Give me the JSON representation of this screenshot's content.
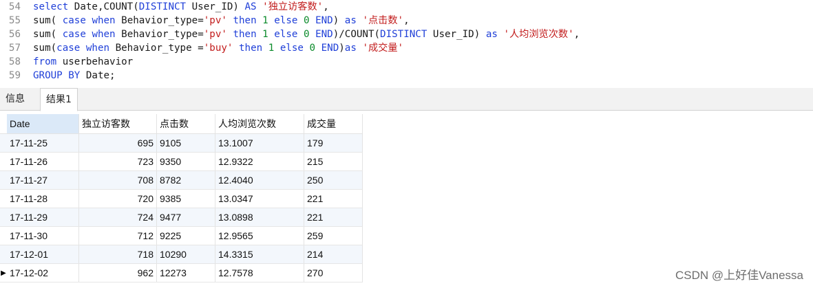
{
  "editor": {
    "lines": [
      {
        "no": "54",
        "parts": [
          {
            "t": "kw",
            "v": "select"
          },
          {
            "t": "id",
            "v": " Date,COUNT("
          },
          {
            "t": "kw",
            "v": "DISTINCT"
          },
          {
            "t": "id",
            "v": " User_ID) "
          },
          {
            "t": "kw",
            "v": "AS"
          },
          {
            "t": "id",
            "v": " "
          },
          {
            "t": "str",
            "v": "'独立访客数'"
          },
          {
            "t": "id",
            "v": ","
          }
        ]
      },
      {
        "no": "55",
        "parts": [
          {
            "t": "id",
            "v": "sum( "
          },
          {
            "t": "kw",
            "v": "case"
          },
          {
            "t": "id",
            "v": " "
          },
          {
            "t": "kw",
            "v": "when"
          },
          {
            "t": "id",
            "v": " Behavior_type="
          },
          {
            "t": "str",
            "v": "'pv'"
          },
          {
            "t": "id",
            "v": " "
          },
          {
            "t": "kw",
            "v": "then"
          },
          {
            "t": "id",
            "v": " "
          },
          {
            "t": "num",
            "v": "1"
          },
          {
            "t": "id",
            "v": " "
          },
          {
            "t": "kw",
            "v": "else"
          },
          {
            "t": "id",
            "v": " "
          },
          {
            "t": "num",
            "v": "0"
          },
          {
            "t": "id",
            "v": " "
          },
          {
            "t": "kw",
            "v": "END"
          },
          {
            "t": "id",
            "v": ") "
          },
          {
            "t": "kw",
            "v": "as"
          },
          {
            "t": "id",
            "v": " "
          },
          {
            "t": "str",
            "v": "'点击数'"
          },
          {
            "t": "id",
            "v": ","
          }
        ]
      },
      {
        "no": "56",
        "parts": [
          {
            "t": "id",
            "v": "sum( "
          },
          {
            "t": "kw",
            "v": "case"
          },
          {
            "t": "id",
            "v": " "
          },
          {
            "t": "kw",
            "v": "when"
          },
          {
            "t": "id",
            "v": " Behavior_type="
          },
          {
            "t": "str",
            "v": "'pv'"
          },
          {
            "t": "id",
            "v": " "
          },
          {
            "t": "kw",
            "v": "then"
          },
          {
            "t": "id",
            "v": " "
          },
          {
            "t": "num",
            "v": "1"
          },
          {
            "t": "id",
            "v": " "
          },
          {
            "t": "kw",
            "v": "else"
          },
          {
            "t": "id",
            "v": " "
          },
          {
            "t": "num",
            "v": "0"
          },
          {
            "t": "id",
            "v": " "
          },
          {
            "t": "kw",
            "v": "END"
          },
          {
            "t": "id",
            "v": ")/COUNT("
          },
          {
            "t": "kw",
            "v": "DISTINCT"
          },
          {
            "t": "id",
            "v": " User_ID) "
          },
          {
            "t": "kw",
            "v": "as"
          },
          {
            "t": "id",
            "v": " "
          },
          {
            "t": "str",
            "v": "'人均浏览次数'"
          },
          {
            "t": "id",
            "v": ","
          }
        ]
      },
      {
        "no": "57",
        "parts": [
          {
            "t": "id",
            "v": "sum("
          },
          {
            "t": "kw",
            "v": "case"
          },
          {
            "t": "id",
            "v": " "
          },
          {
            "t": "kw",
            "v": "when"
          },
          {
            "t": "id",
            "v": " Behavior_type ="
          },
          {
            "t": "str",
            "v": "'buy'"
          },
          {
            "t": "id",
            "v": " "
          },
          {
            "t": "kw",
            "v": "then"
          },
          {
            "t": "id",
            "v": " "
          },
          {
            "t": "num",
            "v": "1"
          },
          {
            "t": "id",
            "v": " "
          },
          {
            "t": "kw",
            "v": "else"
          },
          {
            "t": "id",
            "v": " "
          },
          {
            "t": "num",
            "v": "0"
          },
          {
            "t": "id",
            "v": " "
          },
          {
            "t": "kw",
            "v": "END"
          },
          {
            "t": "id",
            "v": ")"
          },
          {
            "t": "kw",
            "v": "as"
          },
          {
            "t": "id",
            "v": " "
          },
          {
            "t": "str",
            "v": "'成交量'"
          }
        ]
      },
      {
        "no": "58",
        "parts": [
          {
            "t": "kw",
            "v": "from"
          },
          {
            "t": "id",
            "v": " userbehavior"
          }
        ]
      },
      {
        "no": "59",
        "parts": [
          {
            "t": "kw",
            "v": "GROUP BY"
          },
          {
            "t": "id",
            "v": " Date;"
          }
        ]
      }
    ]
  },
  "tabs": [
    {
      "label": "信息",
      "active": false
    },
    {
      "label": "结果1",
      "active": true
    }
  ],
  "result": {
    "columns": [
      "Date",
      "独立访客数",
      "点击数",
      "人均浏览次数",
      "成交量"
    ],
    "current_row_marker": "▶",
    "rows": [
      [
        "17-11-25",
        "695",
        "9105",
        "13.1007",
        "179"
      ],
      [
        "17-11-26",
        "723",
        "9350",
        "12.9322",
        "215"
      ],
      [
        "17-11-27",
        "708",
        "8782",
        "12.4040",
        "250"
      ],
      [
        "17-11-28",
        "720",
        "9385",
        "13.0347",
        "221"
      ],
      [
        "17-11-29",
        "724",
        "9477",
        "13.0898",
        "221"
      ],
      [
        "17-11-30",
        "712",
        "9225",
        "12.9565",
        "259"
      ],
      [
        "17-12-01",
        "718",
        "10290",
        "14.3315",
        "214"
      ],
      [
        "17-12-02",
        "962",
        "12273",
        "12.7578",
        "270"
      ]
    ]
  },
  "watermark": "CSDN @上好佳Vanessa"
}
